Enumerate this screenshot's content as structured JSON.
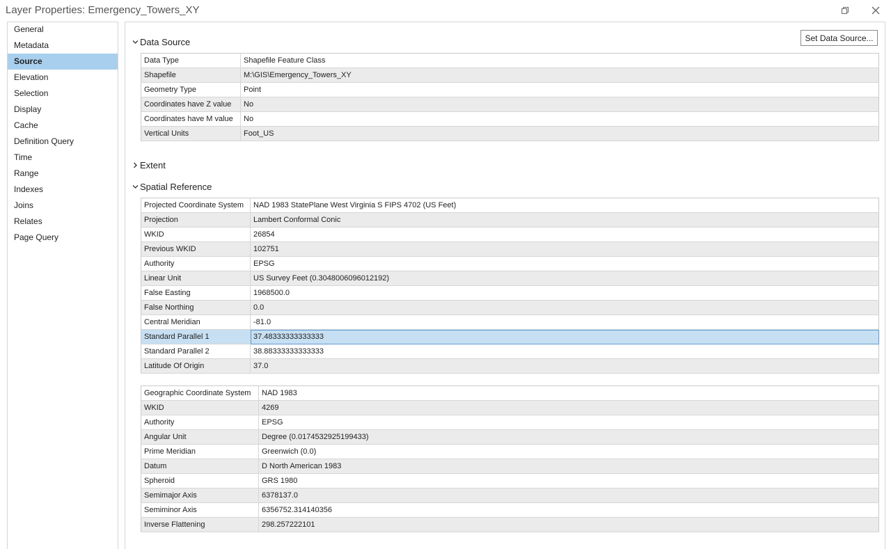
{
  "window": {
    "title": "Layer Properties: Emergency_Towers_XY",
    "restore_icon": "restore-icon",
    "close_icon": "close-icon"
  },
  "sidebar": {
    "items": [
      {
        "label": "General"
      },
      {
        "label": "Metadata"
      },
      {
        "label": "Source",
        "active": true
      },
      {
        "label": "Elevation"
      },
      {
        "label": "Selection"
      },
      {
        "label": "Display"
      },
      {
        "label": "Cache"
      },
      {
        "label": "Definition Query"
      },
      {
        "label": "Time"
      },
      {
        "label": "Range"
      },
      {
        "label": "Indexes"
      },
      {
        "label": "Joins"
      },
      {
        "label": "Relates"
      },
      {
        "label": "Page Query"
      }
    ]
  },
  "main": {
    "set_data_source_label": "Set Data Source...",
    "data_source": {
      "heading": "Data Source",
      "rows": [
        {
          "key": "Data Type",
          "value": "Shapefile Feature Class"
        },
        {
          "key": "Shapefile",
          "value": "M:\\GIS\\Emergency_Towers_XY"
        },
        {
          "key": "Geometry Type",
          "value": "Point"
        },
        {
          "key": "Coordinates have Z value",
          "value": "No"
        },
        {
          "key": "Coordinates have M value",
          "value": "No"
        },
        {
          "key": "Vertical Units",
          "value": "Foot_US"
        }
      ]
    },
    "extent": {
      "heading": "Extent"
    },
    "spatial_reference": {
      "heading": "Spatial Reference",
      "projected_rows": [
        {
          "key": "Projected Coordinate System",
          "value": "NAD 1983 StatePlane West Virginia S FIPS 4702 (US Feet)"
        },
        {
          "key": "Projection",
          "value": "Lambert Conformal Conic"
        },
        {
          "key": "WKID",
          "value": "26854"
        },
        {
          "key": "Previous WKID",
          "value": "102751"
        },
        {
          "key": "Authority",
          "value": "EPSG"
        },
        {
          "key": "Linear Unit",
          "value": "US Survey Feet (0.3048006096012192)"
        },
        {
          "key": "False Easting",
          "value": "1968500.0"
        },
        {
          "key": "False Northing",
          "value": "0.0"
        },
        {
          "key": "Central Meridian",
          "value": "-81.0"
        },
        {
          "key": "Standard Parallel 1",
          "value": "37.48333333333333",
          "selected": true
        },
        {
          "key": "Standard Parallel 2",
          "value": "38.88333333333333"
        },
        {
          "key": "Latitude Of Origin",
          "value": "37.0"
        }
      ],
      "geographic_rows": [
        {
          "key": "Geographic Coordinate System",
          "value": "NAD 1983"
        },
        {
          "key": "WKID",
          "value": "4269"
        },
        {
          "key": "Authority",
          "value": "EPSG"
        },
        {
          "key": "Angular Unit",
          "value": "Degree (0.0174532925199433)"
        },
        {
          "key": "Prime Meridian",
          "value": "Greenwich (0.0)"
        },
        {
          "key": "Datum",
          "value": "D North American 1983"
        },
        {
          "key": "Spheroid",
          "value": "GRS 1980"
        },
        {
          "key": "Semimajor Axis",
          "value": "6378137.0"
        },
        {
          "key": "Semiminor Axis",
          "value": "6356752.314140356"
        },
        {
          "key": "Inverse Flattening",
          "value": "298.257222101"
        }
      ]
    }
  },
  "colors": {
    "active_nav": "#a8d0ee",
    "selected_row": "#c7dff2",
    "selection_border": "#5b9bd5"
  }
}
